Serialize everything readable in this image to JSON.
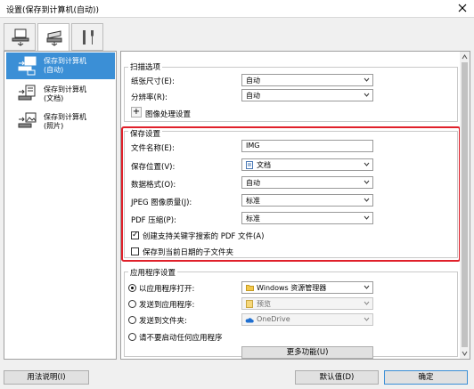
{
  "window": {
    "title": "设置(保存到计算机(自动))"
  },
  "top_tabs": [
    {
      "icon": "scan-from-computer-icon",
      "active": false
    },
    {
      "icon": "scan-from-operation-panel-icon",
      "active": true
    },
    {
      "icon": "general-settings-tools-icon",
      "active": false
    }
  ],
  "sidebar": {
    "items": [
      {
        "label_1": "保存到计算机",
        "label_2": "(自动)",
        "selected": true
      },
      {
        "label_1": "保存到计算机",
        "label_2": "(文档)",
        "selected": false
      },
      {
        "label_1": "保存到计算机",
        "label_2": "(照片)",
        "selected": false
      }
    ]
  },
  "scan_options": {
    "title": "扫描选项",
    "paper_size_label": "纸张尺寸(E):",
    "paper_size_value": "自动",
    "resolution_label": "分辨率(R):",
    "resolution_value": "自动",
    "image_processing_label": "图像处理设置"
  },
  "save_settings": {
    "title": "保存设置",
    "file_name_label": "文件名称(E):",
    "file_name_value": "IMG",
    "save_in_label": "保存位置(V):",
    "save_in_value": "文档",
    "data_format_label": "数据格式(O):",
    "data_format_value": "自动",
    "jpeg_quality_label": "JPEG 图像质量(J):",
    "jpeg_quality_value": "标准",
    "pdf_compression_label": "PDF 压缩(P):",
    "pdf_compression_value": "标准",
    "keyword_pdf_label": "创建支持关键字搜索的 PDF 文件(A)",
    "keyword_pdf_checked": true,
    "date_subfolder_label": "保存到当前日期的子文件夹",
    "date_subfolder_checked": false
  },
  "app_settings": {
    "title": "应用程序设置",
    "open_with_label": "以应用程序打开:",
    "open_with_value": "Windows 资源管理器",
    "send_to_app_label": "发送到应用程序:",
    "send_to_app_value": "预览",
    "send_to_folder_label": "发送到文件夹:",
    "send_to_folder_value": "OneDrive",
    "do_not_start_label": "请不要启动任何应用程序",
    "more_functions_label": "更多功能(U)",
    "selected_option": "open_with"
  },
  "footer": {
    "instructions_label": "用法说明(I)",
    "defaults_label": "默认值(D)",
    "ok_label": "确定"
  },
  "colors": {
    "highlight_box": "#e0202a",
    "selection_blue": "#3b8fd6"
  }
}
